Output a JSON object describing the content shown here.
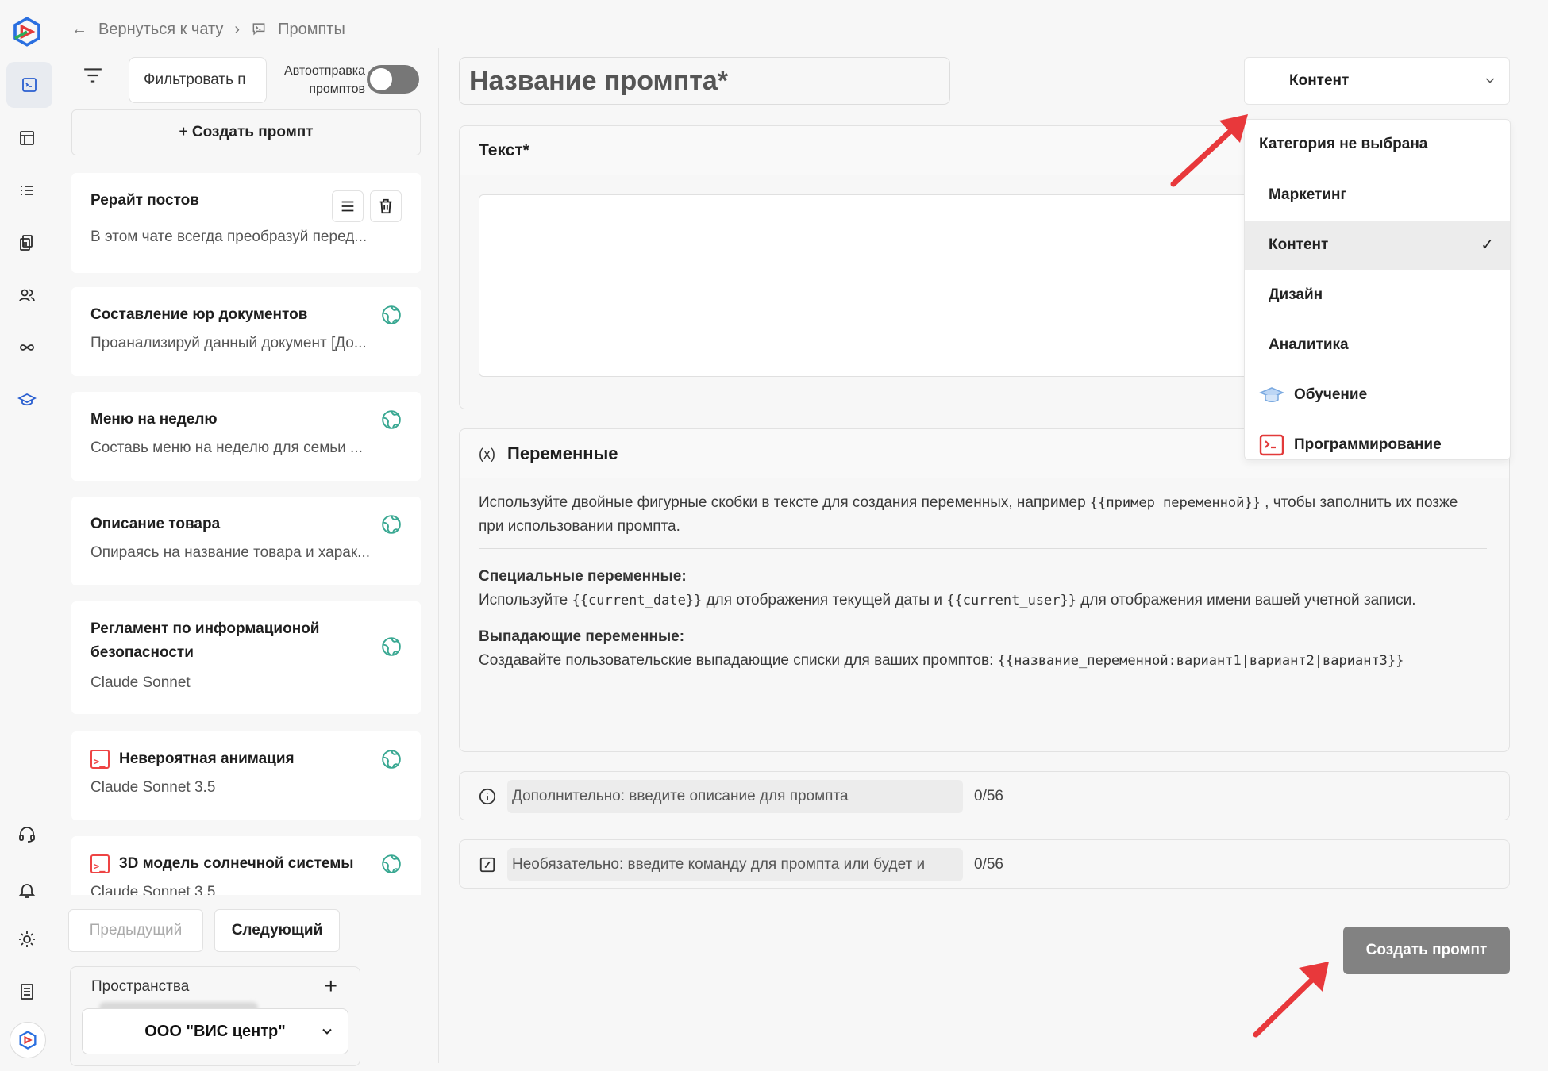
{
  "breadcrumb": {
    "back": "Вернуться к чату",
    "current": "Промпты"
  },
  "left": {
    "filter_label": "Фильтровать п",
    "autosend_label": "Автоотправка промптов",
    "create_label": "+ Создать промпт",
    "prompts": [
      {
        "title": "Рерайт постов",
        "subtitle": "В этом чате всегда преобразуй перед..."
      },
      {
        "title": "Составление юр документов",
        "subtitle": "Проанализируй данный документ [До..."
      },
      {
        "title": "Меню на неделю",
        "subtitle": "Составь меню на неделю для семьи ..."
      },
      {
        "title": "Описание товара",
        "subtitle": "Опираясь на название товара и харак..."
      },
      {
        "title": "Регламент по информационой безопасности",
        "subtitle": "Claude Sonnet"
      },
      {
        "title": "Невероятная анимация",
        "subtitle": "Claude Sonnet 3.5"
      },
      {
        "title": "3D модель солнечной системы",
        "subtitle": "Claude Sonnet 3.5"
      }
    ],
    "prev_label": "Предыдущий",
    "next_label": "Следующий",
    "spaces_label": "Пространства",
    "spaces_plus": "+",
    "workspace": "ООО \"ВИС центр\""
  },
  "editor": {
    "name_placeholder": "Название промпта*",
    "category_selected": "Контент",
    "text_header": "Текст*",
    "vars_header": "Переменные",
    "vars_icon": "(x)",
    "vars_intro_1": "Используйте двойные фигурные скобки в тексте для создания переменных, например",
    "vars_intro_code": "{{пример переменной}}",
    "vars_intro_2": ", чтобы заполнить их позже при использовании промпта.",
    "special_title": "Специальные переменные:",
    "special_1": "Используйте",
    "special_code_1": "{{current_date}}",
    "special_2": "для отображения текущей даты и",
    "special_code_2": "{{current_user}}",
    "special_3": "для отображения имени вашей учетной записи.",
    "dropdown_title": "Выпадающие переменные:",
    "dropdown_1": "Создавайте пользовательские выпадающие списки для ваших промптов:",
    "dropdown_code": "{{название_переменной:вариант1|вариант2|вариант3}}",
    "desc_placeholder": "Дополнительно: введите описание для промпта",
    "desc_count": "0/56",
    "cmd_placeholder": "Необязательно: введите команду для промпта или будет и",
    "cmd_count": "0/56",
    "submit_label": "Создать промпт"
  },
  "categories": [
    {
      "label": "Категория не выбрана"
    },
    {
      "label": "Маркетинг"
    },
    {
      "label": "Контент",
      "check": "✓"
    },
    {
      "label": "Дизайн"
    },
    {
      "label": "Аналитика"
    },
    {
      "label": "Обучение"
    },
    {
      "label": "Программирование"
    }
  ],
  "colors": {
    "accent_red": "#e8383b",
    "toggle_off": "#777777",
    "submit_bg": "#828282",
    "globe": "#39a892"
  }
}
